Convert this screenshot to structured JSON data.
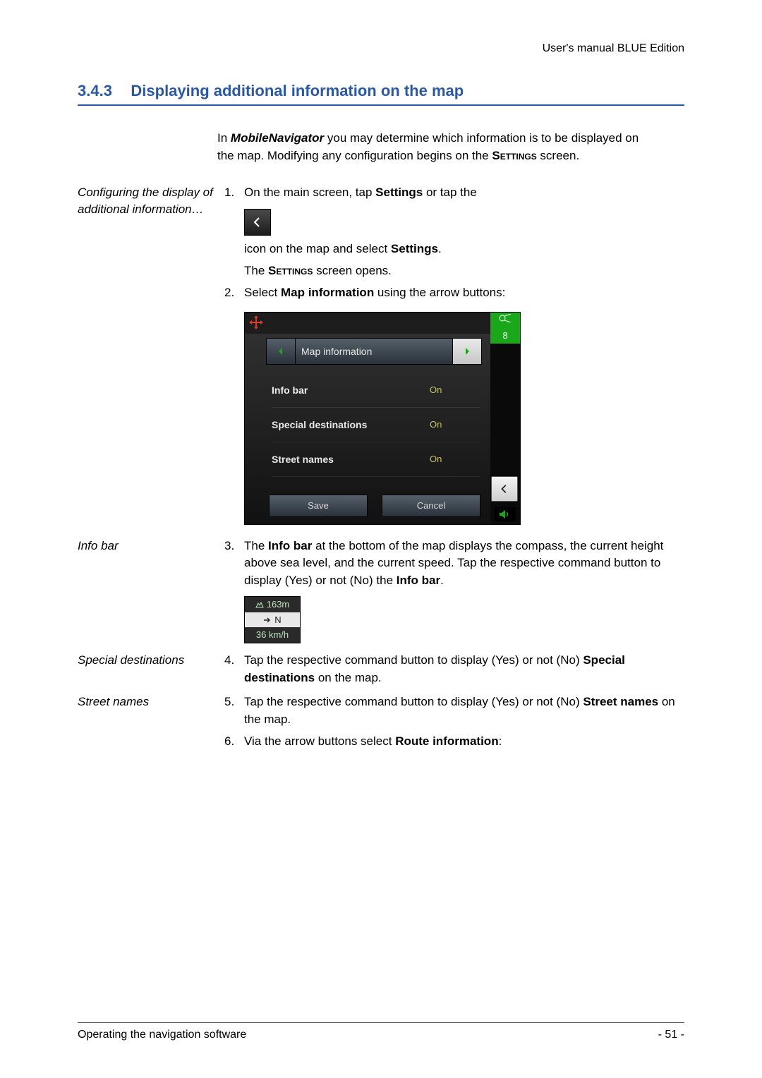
{
  "header": {
    "running_head": "User's manual BLUE Edition"
  },
  "section": {
    "number": "3.4.3",
    "title": "Displaying additional information on the map"
  },
  "intro": {
    "pre": "In ",
    "product": "MobileNavigator",
    "mid": " you may determine which information is to be displayed on the map. Modifying any configuration begins on the ",
    "smallcaps": "Settings",
    "post": " screen."
  },
  "notes": {
    "configure": "Configuring the display of additional information…",
    "infobar": "Info bar",
    "specialdest": "Special destinations",
    "streetnames": "Street names"
  },
  "steps": {
    "s1": {
      "num": "1.",
      "pre": "On the main screen, tap ",
      "bold1": "Settings",
      "post": " or tap the",
      "after_icon_pre": "icon on the map and select ",
      "after_icon_bold": "Settings",
      "after_icon_post": ".",
      "result_pre": "The ",
      "result_sc": "Settings",
      "result_post": " screen opens."
    },
    "s2": {
      "num": "2.",
      "pre": "Select ",
      "bold": "Map information",
      "post": " using the arrow buttons:"
    },
    "s3": {
      "num": "3.",
      "pre": "The ",
      "bold1": "Info bar",
      "mid": " at the bottom of the map displays the compass, the current height above sea level, and the current speed. Tap the respective command button to display (Yes) or not (No) the ",
      "bold2": "Info bar",
      "post": "."
    },
    "s4": {
      "num": "4.",
      "pre": "Tap the respective command button to display (Yes) or not (No) ",
      "bold": "Special destinations",
      "post": " on the map."
    },
    "s5": {
      "num": "5.",
      "pre": "Tap the respective command button to display (Yes) or not (No) ",
      "bold": "Street names",
      "post": " on the map."
    },
    "s6": {
      "num": "6.",
      "pre": "Via the arrow buttons select ",
      "bold": "Route information",
      "post": ":"
    }
  },
  "device": {
    "tab_title": "Map information",
    "gps_count": "8",
    "rows": [
      {
        "label": "Info bar",
        "value": "On"
      },
      {
        "label": "Special destinations",
        "value": "On"
      },
      {
        "label": "Street names",
        "value": "On"
      }
    ],
    "save": "Save",
    "cancel": "Cancel"
  },
  "infobar_widget": {
    "altitude": "163m",
    "direction": "N",
    "speed": "36 km/h"
  },
  "footer": {
    "left": "Operating the navigation software",
    "right": "- 51 -"
  }
}
